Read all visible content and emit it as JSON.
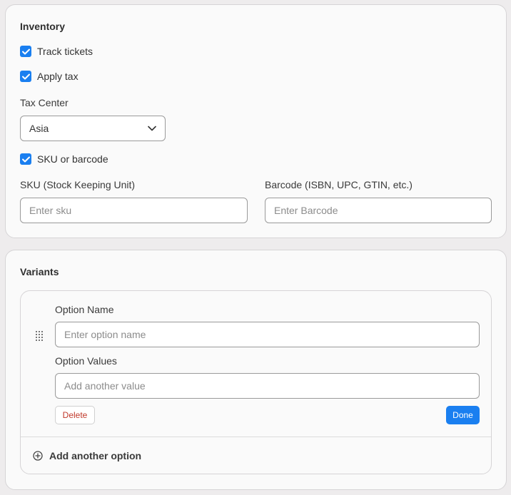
{
  "inventory": {
    "title": "Inventory",
    "track_tickets": {
      "label": "Track tickets",
      "checked": true
    },
    "apply_tax": {
      "label": "Apply tax",
      "checked": true
    },
    "tax_center": {
      "label": "Tax Center",
      "value": "Asia"
    },
    "sku_or_barcode": {
      "label": "SKU or barcode",
      "checked": true
    },
    "sku": {
      "label": "SKU (Stock Keeping Unit)",
      "placeholder": "Enter sku",
      "value": ""
    },
    "barcode": {
      "label": "Barcode (ISBN, UPC, GTIN, etc.)",
      "placeholder": "Enter Barcode",
      "value": ""
    }
  },
  "variants": {
    "title": "Variants",
    "option": {
      "name_label": "Option Name",
      "name_placeholder": "Enter option name",
      "values_label": "Option Values",
      "values_placeholder": "Add another value",
      "delete_label": "Delete",
      "done_label": "Done"
    },
    "add_option_label": "Add another option"
  },
  "colors": {
    "accent": "#1a7ff0",
    "danger": "#c0392b",
    "background": "#eeeced",
    "card": "#fafafa"
  },
  "icons": {
    "checkbox": "checkmark-icon",
    "select": "chevron-down-icon",
    "drag": "drag-handle-icon",
    "add": "plus-circle-icon"
  }
}
